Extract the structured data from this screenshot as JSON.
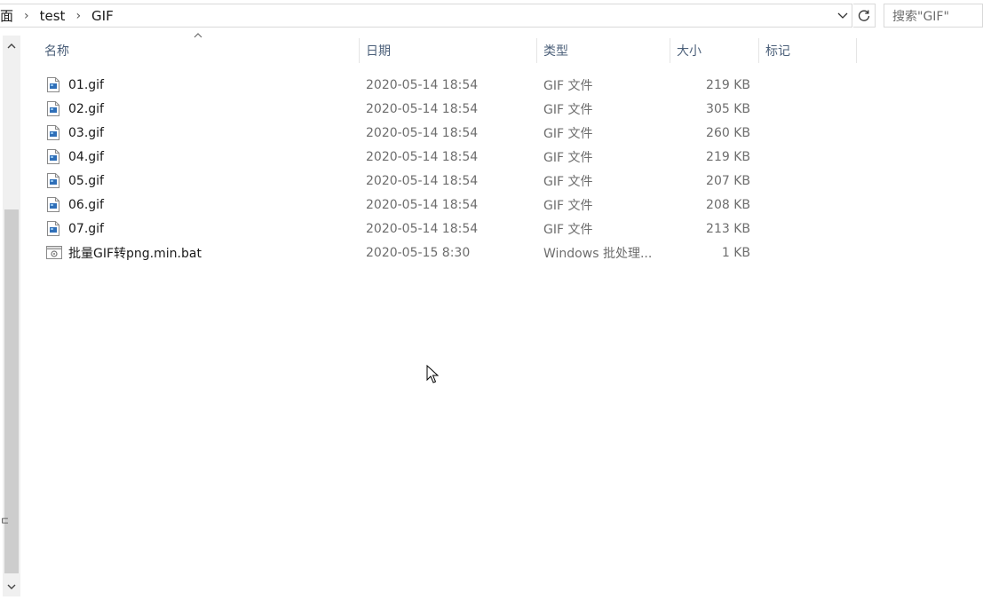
{
  "address": {
    "crumbs": [
      "面",
      "test",
      "GIF"
    ],
    "separator": "›"
  },
  "search": {
    "placeholder": "搜索\"GIF\""
  },
  "columns": {
    "name": "名称",
    "date": "日期",
    "type": "类型",
    "size": "大小",
    "tags": "标记"
  },
  "files": [
    {
      "name": "01.gif",
      "date": "2020-05-14 18:54",
      "type": "GIF 文件",
      "size": "219 KB",
      "icon": "gif-image-icon"
    },
    {
      "name": "02.gif",
      "date": "2020-05-14 18:54",
      "type": "GIF 文件",
      "size": "305 KB",
      "icon": "gif-image-icon"
    },
    {
      "name": "03.gif",
      "date": "2020-05-14 18:54",
      "type": "GIF 文件",
      "size": "260 KB",
      "icon": "gif-image-icon"
    },
    {
      "name": "04.gif",
      "date": "2020-05-14 18:54",
      "type": "GIF 文件",
      "size": "219 KB",
      "icon": "gif-image-icon"
    },
    {
      "name": "05.gif",
      "date": "2020-05-14 18:54",
      "type": "GIF 文件",
      "size": "207 KB",
      "icon": "gif-image-icon"
    },
    {
      "name": "06.gif",
      "date": "2020-05-14 18:54",
      "type": "GIF 文件",
      "size": "208 KB",
      "icon": "gif-image-icon"
    },
    {
      "name": "07.gif",
      "date": "2020-05-14 18:54",
      "type": "GIF 文件",
      "size": "213 KB",
      "icon": "gif-image-icon"
    },
    {
      "name": "批量GIF转png.min.bat",
      "date": "2020-05-15 8:30",
      "type": "Windows 批处理...",
      "size": "1 KB",
      "icon": "batch-file-icon"
    }
  ],
  "left_edge_mark": "ㄷ",
  "colors": {
    "header_text": "#4c607a",
    "secondary_text": "#6d6d6d",
    "border": "#d9d9d9",
    "scroll_track": "#f0f0f0",
    "scroll_thumb": "#cdcdcd"
  }
}
